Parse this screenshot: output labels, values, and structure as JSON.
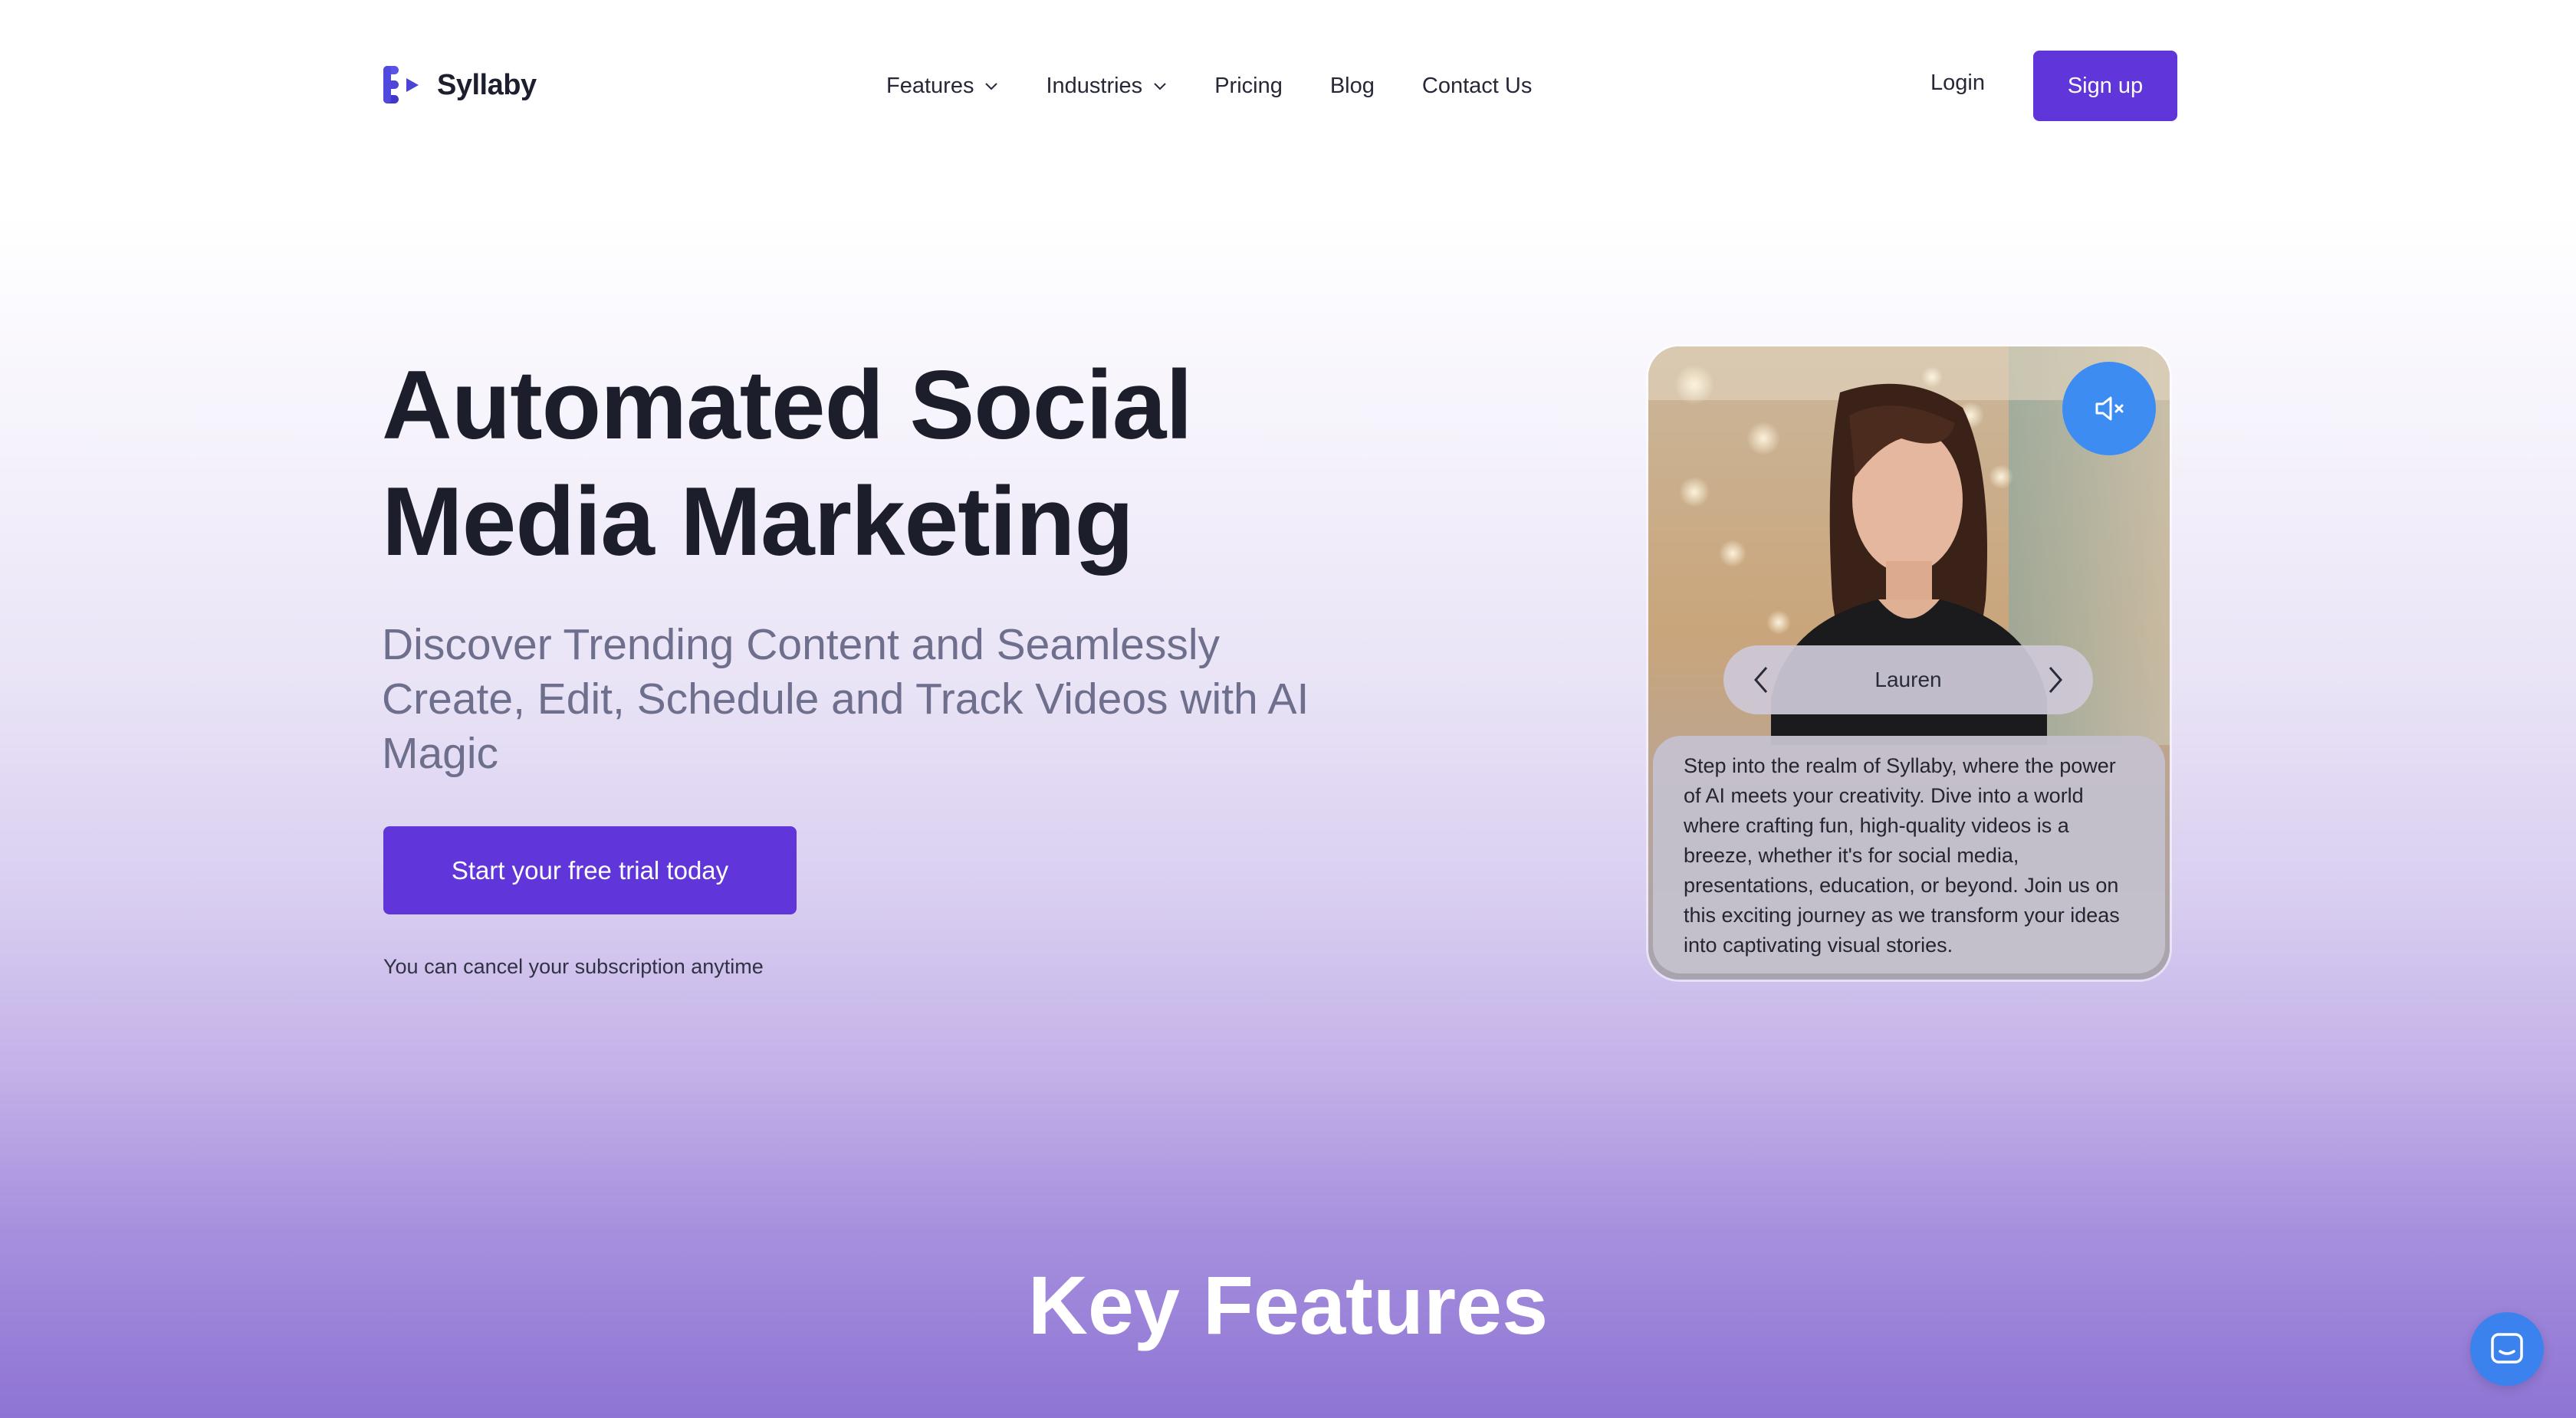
{
  "brand": {
    "name": "Syllaby",
    "accent": "#6035d9"
  },
  "nav": {
    "items": [
      {
        "label": "Features",
        "has_dropdown": true
      },
      {
        "label": "Industries",
        "has_dropdown": true
      },
      {
        "label": "Pricing",
        "has_dropdown": false
      },
      {
        "label": "Blog",
        "has_dropdown": false
      },
      {
        "label": "Contact Us",
        "has_dropdown": false
      }
    ],
    "login_label": "Login",
    "signup_label": "Sign up"
  },
  "hero": {
    "title_line1": "Automated Social",
    "title_line2": "Media Marketing",
    "subtitle": "Discover Trending Content and Seamlessly Create, Edit, Schedule and Track Videos with AI Magic",
    "cta_label": "Start your free trial today",
    "note": "You can cancel your subscription anytime"
  },
  "video_card": {
    "mute_icon": "speaker-muted-icon",
    "avatar_name": "Lauren",
    "speech": "Step into the realm of Syllaby, where the power of AI meets your creativity. Dive into a world where crafting fun, high-quality videos is a breeze, whether it's for social media, presentations, education, or beyond. Join us on this exciting journey as we transform your ideas into captivating visual stories."
  },
  "section": {
    "heading": "Key Features"
  },
  "chat_widget": {
    "icon": "chat-icon",
    "color": "#3b82ef"
  }
}
